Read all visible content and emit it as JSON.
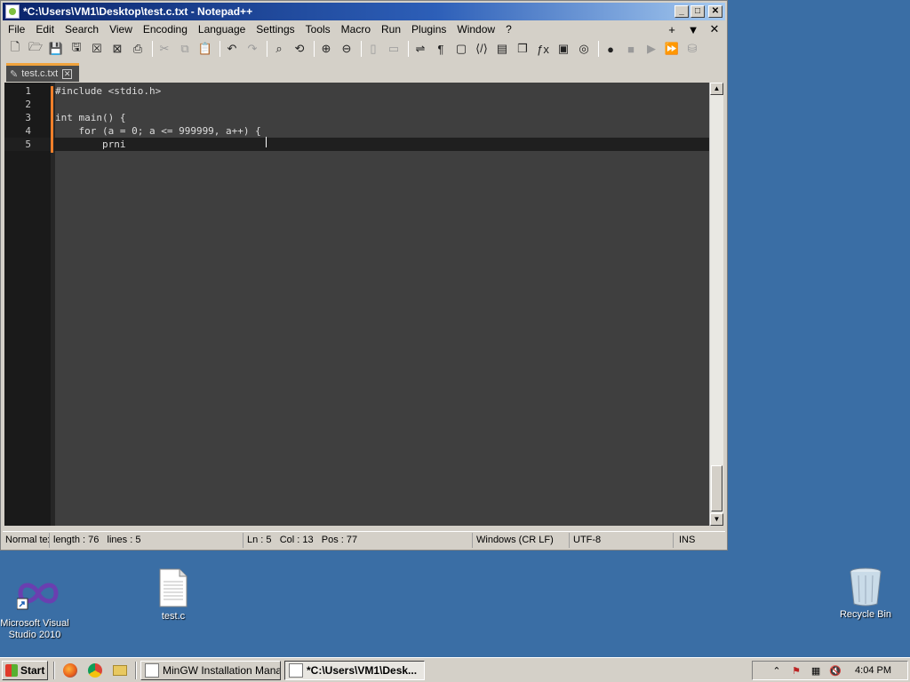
{
  "window": {
    "title": "*C:\\Users\\VM1\\Desktop\\test.c.txt - Notepad++",
    "min_glyph": "_",
    "max_glyph": "□",
    "close_glyph": "✕"
  },
  "menu": {
    "items": [
      "File",
      "Edit",
      "Search",
      "View",
      "Encoding",
      "Language",
      "Settings",
      "Tools",
      "Macro",
      "Run",
      "Plugins",
      "Window",
      "?"
    ],
    "right_plus": "+",
    "right_arrow": "▼",
    "right_close": "✕"
  },
  "toolbar": {
    "icons": [
      {
        "name": "new-file-icon",
        "glyph": "🗋",
        "dim": false
      },
      {
        "name": "open-file-icon",
        "glyph": "🗁",
        "dim": false
      },
      {
        "name": "save-icon",
        "glyph": "💾",
        "dim": false
      },
      {
        "name": "save-all-icon",
        "glyph": "🖫",
        "dim": false
      },
      {
        "name": "close-icon",
        "glyph": "☒",
        "dim": false
      },
      {
        "name": "close-all-icon",
        "glyph": "⊠",
        "dim": false
      },
      {
        "name": "print-icon",
        "glyph": "⎙",
        "dim": false
      },
      {
        "sep": true
      },
      {
        "name": "cut-icon",
        "glyph": "✂",
        "dim": true
      },
      {
        "name": "copy-icon",
        "glyph": "⧉",
        "dim": true
      },
      {
        "name": "paste-icon",
        "glyph": "📋",
        "dim": true
      },
      {
        "sep": true
      },
      {
        "name": "undo-icon",
        "glyph": "↶",
        "dim": false
      },
      {
        "name": "redo-icon",
        "glyph": "↷",
        "dim": true
      },
      {
        "sep": true
      },
      {
        "name": "find-icon",
        "glyph": "⌕",
        "dim": false
      },
      {
        "name": "replace-icon",
        "glyph": "⟲",
        "dim": false
      },
      {
        "sep": true
      },
      {
        "name": "zoom-in-icon",
        "glyph": "⊕",
        "dim": false
      },
      {
        "name": "zoom-out-icon",
        "glyph": "⊖",
        "dim": false
      },
      {
        "sep": true
      },
      {
        "name": "sync-vertical-icon",
        "glyph": "▯",
        "dim": true
      },
      {
        "name": "sync-horizontal-icon",
        "glyph": "▭",
        "dim": true
      },
      {
        "sep": true
      },
      {
        "name": "word-wrap-icon",
        "glyph": "⇌",
        "dim": false
      },
      {
        "name": "show-all-chars-icon",
        "glyph": "¶",
        "dim": false
      },
      {
        "name": "indent-guide-icon",
        "glyph": "▢",
        "dim": false
      },
      {
        "name": "xml-tag-icon",
        "glyph": "⟨/⟩",
        "dim": false
      },
      {
        "name": "document-map-icon",
        "glyph": "▤",
        "dim": false
      },
      {
        "name": "document-list-icon",
        "glyph": "❐",
        "dim": false
      },
      {
        "name": "function-list-icon",
        "glyph": "ƒx",
        "dim": false
      },
      {
        "name": "folder-workspace-icon",
        "glyph": "▣",
        "dim": false
      },
      {
        "name": "monitoring-icon",
        "glyph": "◎",
        "dim": false
      },
      {
        "sep": true
      },
      {
        "name": "record-macro-icon",
        "glyph": "●",
        "dim": false
      },
      {
        "name": "stop-record-icon",
        "glyph": "■",
        "dim": true
      },
      {
        "name": "play-macro-icon",
        "glyph": "▶",
        "dim": true
      },
      {
        "name": "run-macro-multiple-icon",
        "glyph": "⏩",
        "dim": false
      },
      {
        "name": "save-macro-icon",
        "glyph": "⛁",
        "dim": true
      }
    ]
  },
  "tab": {
    "label": "test.c.txt",
    "pencil": "✎",
    "close_glyph": "✕"
  },
  "editor": {
    "lines": [
      {
        "num": "1",
        "code": "#include <stdio.h>"
      },
      {
        "num": "2",
        "code": ""
      },
      {
        "num": "3",
        "code": "int main() {"
      },
      {
        "num": "4",
        "code": "    for (a = 0; a <= 999999, a++) {"
      },
      {
        "num": "5",
        "code": "        prni"
      }
    ],
    "current_line": 5
  },
  "status": {
    "type": "Normal text file",
    "length": "length : 76",
    "lines": "lines : 5",
    "ln": "Ln : 5",
    "col": "Col : 13",
    "pos": "Pos : 77",
    "eol": "Windows (CR LF)",
    "encoding": "UTF-8",
    "mode": "INS"
  },
  "desktop": {
    "icons": [
      {
        "label": "Microsoft Visual Studio 2010"
      },
      {
        "label": "test.c"
      },
      {
        "label": "Recycle Bin"
      }
    ]
  },
  "taskbar": {
    "start": "Start",
    "tasks": [
      {
        "label": "MinGW Installation Mana...",
        "active": false
      },
      {
        "label": "*C:\\Users\\VM1\\Desk...",
        "active": true
      }
    ],
    "clock": "4:04 PM"
  }
}
